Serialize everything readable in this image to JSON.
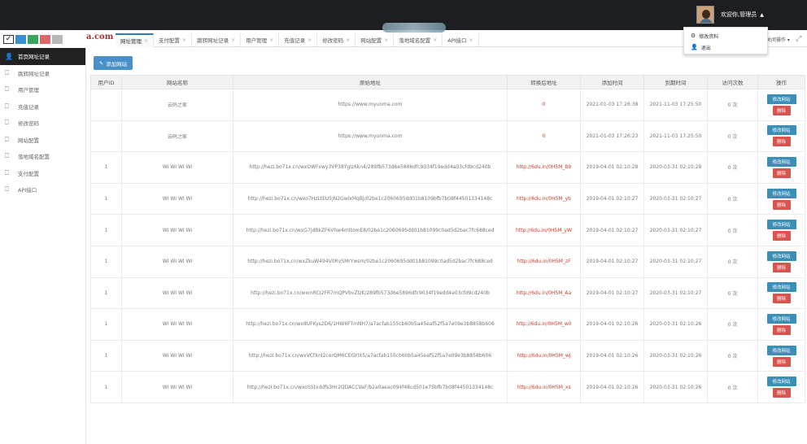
{
  "header": {
    "welcome": "欢迎你,管理员",
    "user_menu": [
      {
        "icon": "gear-icon",
        "label": "修改资料"
      },
      {
        "icon": "user-logout-icon",
        "label": "退出"
      }
    ]
  },
  "logo": {
    "text": "a.com"
  },
  "tabs": [
    {
      "label": "网址管理",
      "active": true
    },
    {
      "label": "支付配置"
    },
    {
      "label": "跳转网址记录"
    },
    {
      "label": "用户管理"
    },
    {
      "label": "充值记录"
    },
    {
      "label": "修改密码"
    },
    {
      "label": "网站配置"
    },
    {
      "label": "落地域名配置"
    },
    {
      "label": "API接口"
    }
  ],
  "tab_ops": "关闭操作",
  "sidebar": {
    "items": [
      {
        "label": "首页网址记录",
        "active": true
      },
      {
        "label": "跳转网址记录"
      },
      {
        "label": "用户管理"
      },
      {
        "label": "充值记录"
      },
      {
        "label": "修改密码"
      },
      {
        "label": "网站配置"
      },
      {
        "label": "落地域名配置"
      },
      {
        "label": "支付配置"
      },
      {
        "label": "API接口"
      }
    ]
  },
  "toolbar": {
    "add_label": "添加网站"
  },
  "table": {
    "columns": [
      "用户ID",
      "网站名称",
      "原始地址",
      "转换后地址",
      "添加时间",
      "到期时间",
      "访问次数",
      "操作"
    ],
    "edit_label": "修改网站",
    "delete_label": "删除",
    "rows": [
      {
        "uid": "",
        "name": "云码之家",
        "orig": "https://www.myunma.com",
        "conv": "0",
        "added": "2021-01-03 17:26:38",
        "expire": "2021-11-03 17:25:50",
        "visits": "0 次"
      },
      {
        "uid": "",
        "name": "云码之家",
        "orig": "https://www.myunma.com",
        "conv": "0",
        "added": "2021-01-03 17:26:23",
        "expire": "2021-11-03 17:25:50",
        "visits": "0 次"
      },
      {
        "uid": "1",
        "name": "WI WI WI WI",
        "orig": "http://hezi.bo71x.cn/wxOWFxwy3VP38Yglz6kn4/289fb573d6e5896dfc9034f19edd4a03cfd9cd240b",
        "conv": "http://6du.in/0H5M_B9",
        "added": "2019-04-01 02:10:28",
        "expire": "2020-03-31 02:10:28",
        "visits": "0 次"
      },
      {
        "uid": "1",
        "name": "WI WI WI WI",
        "orig": "http://hezi.bo71x.cn/wxo7HzLtEU5jN2GwlxMqBj/02be1c2060695dd01b8109bfb7b08f44501334148c",
        "conv": "http://6du.in/0H5M_yb",
        "added": "2019-04-01 02:10:27",
        "expire": "2020-03-31 02:10:27",
        "visits": "0 次"
      },
      {
        "uid": "1",
        "name": "WI WI WI WI",
        "orig": "http://hezi.bo71x.cn/wxG7jdBkZF6Vhw4mItomE8/02be1c2060695dd01b81099c0ad5d2bac7fc688ced",
        "conv": "http://6du.in/0H5M_yW",
        "added": "2019-04-01 02:10:27",
        "expire": "2020-03-31 02:10:27",
        "visits": "0 次"
      },
      {
        "uid": "1",
        "name": "WI WI WI WI",
        "orig": "http://hezi.bo71x.cn/wxZkuW494V0RvSMrYwsm/02be1c2060695dd01b81099c0ad5d2bac7fc688ced",
        "conv": "http://6du.in/0H5M_zF",
        "added": "2019-04-01 02:10:27",
        "expire": "2020-03-31 02:10:27",
        "visits": "0 次"
      },
      {
        "uid": "1",
        "name": "WI WI WI WI",
        "orig": "http://hezi.bo71x.cn/wxmRCI2FR7mQPVbvZlzK/289fb573d6e5896dfc9034f19edd4a03cfd9cd240b",
        "conv": "http://6du.in/0H5M_Aa",
        "added": "2019-04-01 02:10:27",
        "expire": "2020-03-31 02:10:27",
        "visits": "0 次"
      },
      {
        "uid": "1",
        "name": "WI WI WI WI",
        "orig": "http://hezi.bo71x.cn/wx8UFKys2D6/1HW6FTmNH7/a7acfab155cb60b5a45eaf52f5a7e09e3b8858b606",
        "conv": "http://6du.in/0H5M_w0",
        "added": "2019-04-01 02:10:26",
        "expire": "2020-03-31 02:10:26",
        "visits": "0 次"
      },
      {
        "uid": "1",
        "name": "WI WI WI WI",
        "orig": "http://hezi.bo71x.cn/wxVCfXnl2cerQM6CEGYlX5/a7acfab155cb60b5a45eaf52f5a7e09e3b8858b606",
        "conv": "http://6du.in/0H5M_wJ",
        "added": "2019-04-01 02:10:26",
        "expire": "2020-03-31 02:10:26",
        "visits": "0 次"
      },
      {
        "uid": "1",
        "name": "WI WI WI WI",
        "orig": "http://hezi.bo71x.cn/wxoSStxddfs3Hr2QDACCVaF/b2a0aeac094f48cd501e75bfb7b08f44501334148c",
        "conv": "http://6du.in/0H5M_xs",
        "added": "2019-04-01 02:10:26",
        "expire": "2020-03-31 02:10:26",
        "visits": "0 次"
      }
    ]
  },
  "colors": {
    "topbar": "#1d1e22",
    "primary": "#3a8fb7",
    "danger": "#d9534f",
    "link_red": "#d03b2a"
  }
}
